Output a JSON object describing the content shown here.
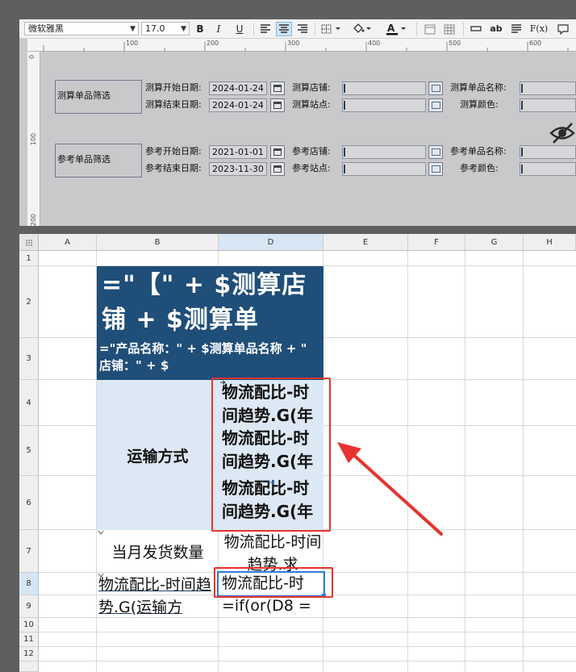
{
  "toolbar": {
    "font_family": "微软雅黑",
    "font_size": "17.0",
    "bold_label": "B",
    "italic_label": "I",
    "underline_label": "U",
    "wrap_label": "ab",
    "formula_label": "F(x)",
    "icons": [
      "align-left-icon",
      "align-center-icon",
      "align-right-icon",
      "border-icon",
      "fill-color-icon",
      "font-color-icon",
      "merge-icon",
      "grid-icon",
      "text-icon",
      "wrap-text-icon",
      "paragraph-icon",
      "formula-icon"
    ]
  },
  "ruler": {
    "top_marks": [
      "100",
      "200",
      "300",
      "400",
      "500",
      "600"
    ],
    "left_marks": [
      "0",
      "100",
      "200"
    ]
  },
  "param_panel": {
    "group1": {
      "title": "测算单品筛选",
      "start_label": "测算开始日期:",
      "start_value": "2024-01-24",
      "end_label": "测算结束日期:",
      "end_value": "2024-01-24",
      "store_label": "测算店铺:",
      "site_label": "测算站点:",
      "name_label": "测算单品名称:",
      "color_label": "测算颜色:"
    },
    "group2": {
      "title": "参考单品筛选",
      "start_label": "参考开始日期:",
      "start_value": "2021-01-01",
      "end_label": "参考结束日期:",
      "end_value": "2023-11-30",
      "store_label": "参考店铺:",
      "site_label": "参考站点:",
      "name_label": "参考单品名称:",
      "color_label": "参考颜色:"
    },
    "hide_icon": "eye-slash-icon"
  },
  "sheet": {
    "columns": [
      "A",
      "B",
      "D",
      "E",
      "F",
      "G",
      "H"
    ],
    "rows": [
      "1",
      "2",
      "3",
      "4",
      "5",
      "6",
      "7",
      "8",
      "9",
      "10",
      "11",
      "12"
    ],
    "cells": {
      "B2": "=\"【\" + $测算店铺 + $测算单",
      "B3": "=\"产品名称：\" + $测算单品名称 + \" 店铺：\" + $",
      "B4_6": "运输方式",
      "D4": "物流配比-时间趋势.G(年",
      "D5": "物流配比-时间趋势.G(年",
      "D6": "物流配比-时间趋势.G(年",
      "B7": "当月发货数量",
      "D7": "物流配比-时间趋势.求",
      "B8_9": "物流配比-时间趋势.G(运输方",
      "D8": "物流配比-时",
      "D9": "=if(or(D8 ="
    },
    "colors": {
      "header_dark": "#1f4e79",
      "header_light": "#dce8f4",
      "highlight_red": "#e8322f",
      "selection_blue": "#2f7bd9"
    }
  }
}
